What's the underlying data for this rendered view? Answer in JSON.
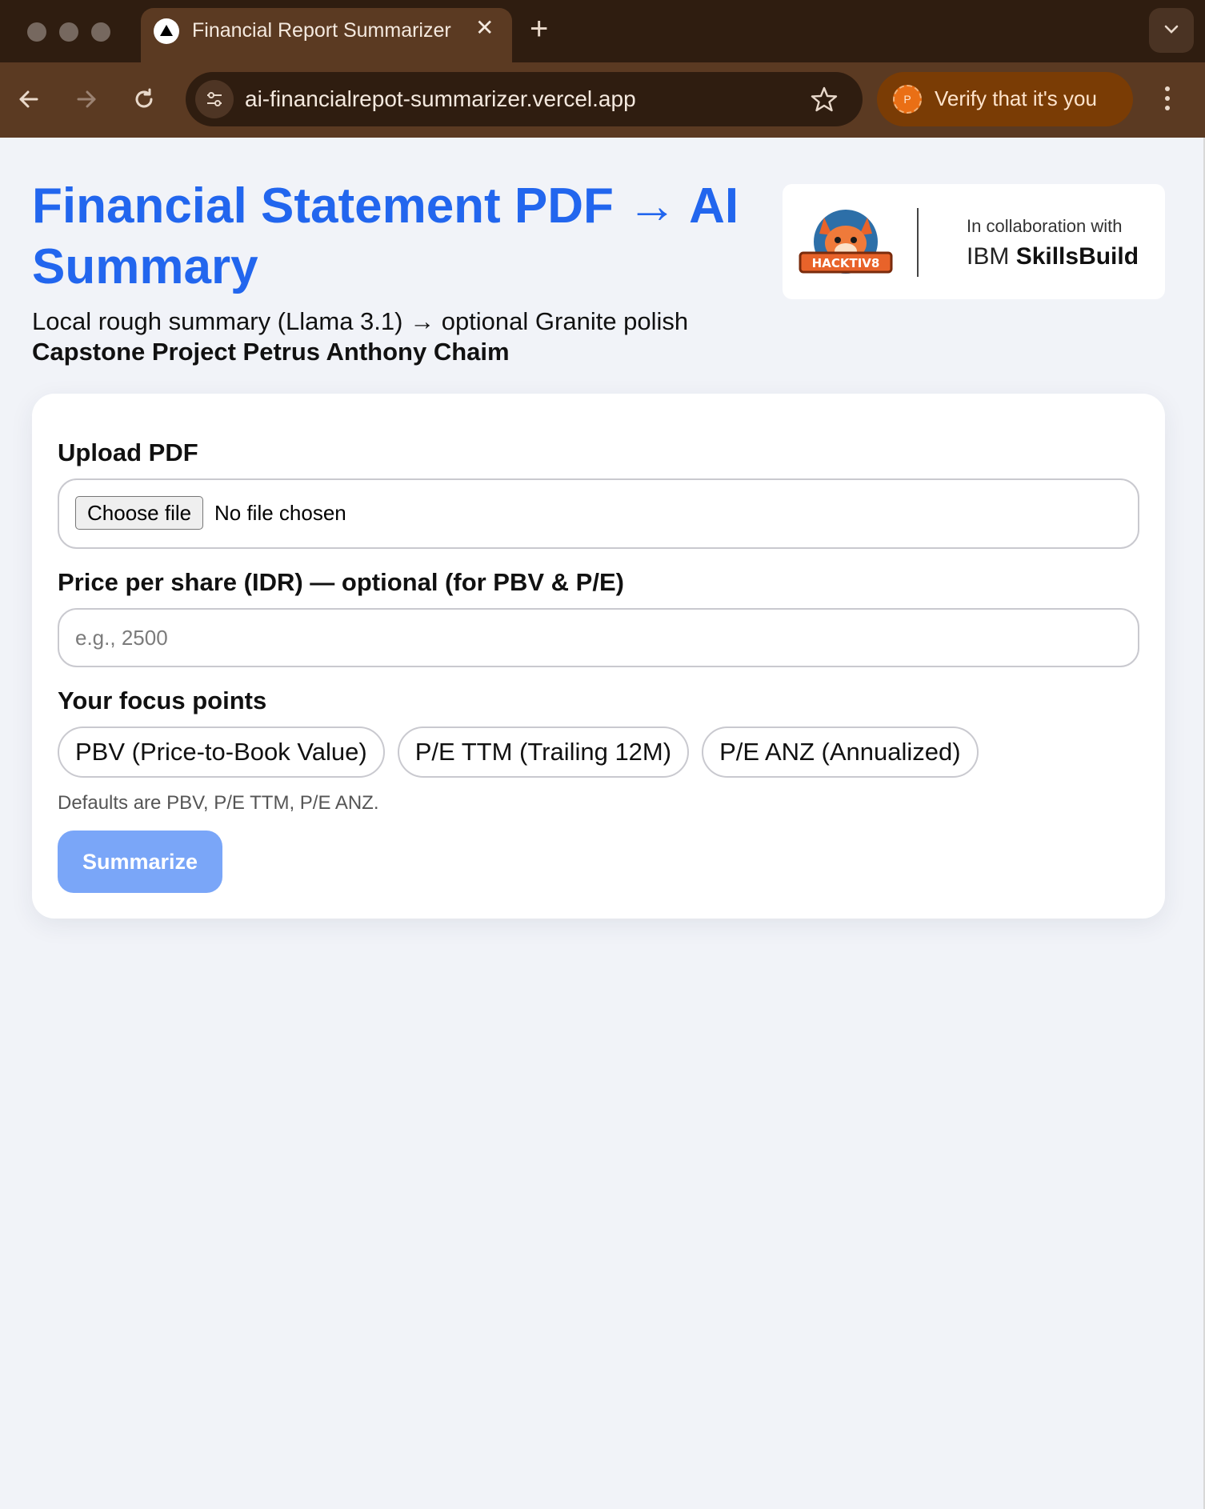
{
  "browser": {
    "tab_title": "Financial Report Summarizer",
    "tab_close": "✕",
    "new_tab": "+",
    "url": "ai-financialrepot-summarizer.vercel.app",
    "profile_initial": "P",
    "verify_label": "Verify that it's you"
  },
  "header": {
    "title": "Financial Statement PDF → AI Summary",
    "subtitle": "Local rough summary (Llama 3.1) → optional Granite polish",
    "author": "Capstone Project Petrus Anthony Chaim"
  },
  "logo": {
    "mascot_text": "HACKTIV8",
    "collab": "In collaboration with",
    "ibm_prefix": "IBM",
    "ibm_name": "SkillsBuild"
  },
  "form": {
    "upload_label": "Upload PDF",
    "choose_file": "Choose file",
    "file_status": "No file chosen",
    "price_label": "Price per share (IDR) — optional (for PBV & P/E)",
    "price_placeholder": "e.g., 2500",
    "price_value": "",
    "focus_label": "Your focus points",
    "focus_points": [
      "PBV (Price-to-Book Value)",
      "P/E TTM (Trailing 12M)",
      "P/E ANZ (Annualized)"
    ],
    "hint": "Defaults are PBV, P/E TTM, P/E ANZ.",
    "submit_label": "Summarize"
  },
  "colors": {
    "accent": "#2266ee",
    "button_disabled": "#7aa6f8",
    "tab_bar": "#2f1d10",
    "toolbar": "#5b3a22",
    "verify_pill": "#7a3c05"
  }
}
